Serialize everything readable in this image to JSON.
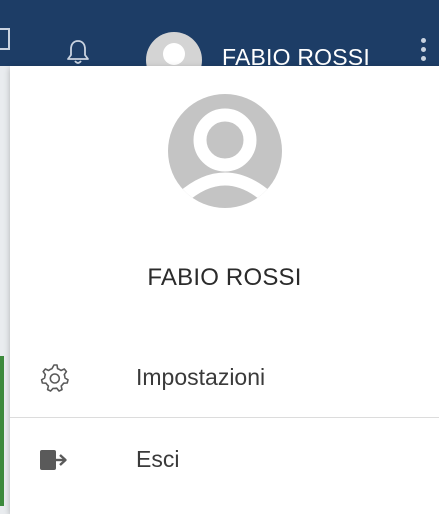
{
  "topbar": {
    "user_name": "FABIO ROSSI"
  },
  "menu": {
    "profile_name": "FABIO ROSSI",
    "items": [
      {
        "label": "Impostazioni",
        "icon": "gear-icon"
      },
      {
        "label": "Esci",
        "icon": "logout-icon"
      }
    ]
  },
  "colors": {
    "topbar_bg": "#1d3d66",
    "avatar_bg": "#c4c4c4",
    "text": "#3a3a3a"
  }
}
